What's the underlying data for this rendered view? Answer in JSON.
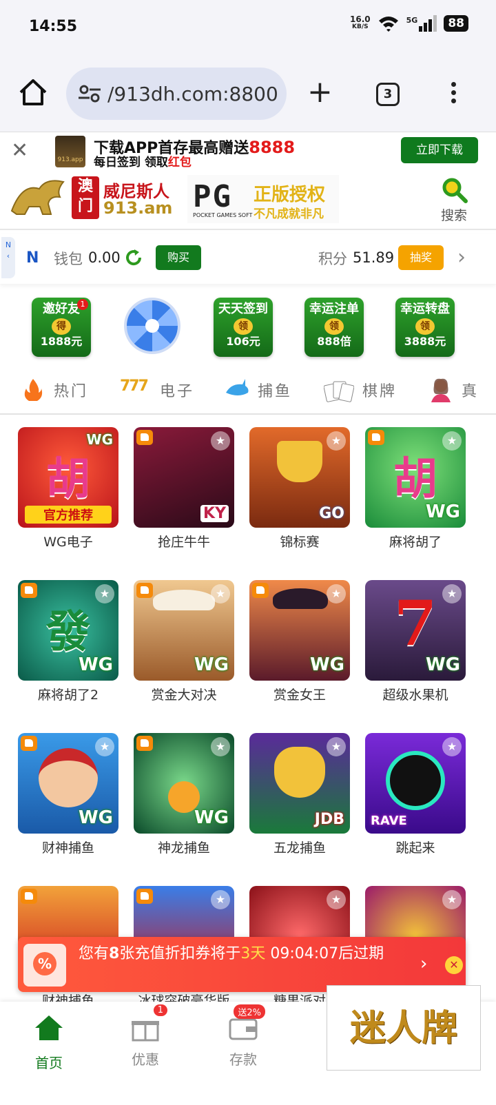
{
  "status": {
    "time": "14:55",
    "speed_value": "16.0",
    "speed_unit": "KB/S",
    "network": "5G",
    "battery": "88"
  },
  "browser": {
    "url": "/913dh.com:8800",
    "tab_count": "3"
  },
  "download_bar": {
    "line1_prefix": "下载APP首存最高赠送",
    "line1_amount": "8888",
    "line2_prefix": "每日签到 领取",
    "line2_highlight": "红包",
    "logo_caption": "913.app",
    "button": "立即下载"
  },
  "brand": {
    "macau": "澳门",
    "name": "威尼斯人",
    "domain": "913.am",
    "pg_logo": "PG",
    "pg_sub": "POCKET GAMES SOFT",
    "pg_title": "正版授权",
    "pg_slogan": "不凡成就非凡",
    "search_label": "搜索"
  },
  "wallet": {
    "side_tab": "N",
    "wallet_label": "钱包",
    "wallet_value": "0.00",
    "buy_button": "购买",
    "points_label": "积分",
    "points_value": "51.89",
    "lottery_button": "抽奖"
  },
  "promos": [
    {
      "title": "邀好友",
      "coin": "得",
      "value": "1888元",
      "badge": "1"
    },
    {
      "title": "天天签到",
      "coin": "领",
      "value": "106元"
    },
    {
      "title": "幸运注单",
      "coin": "领",
      "value": "888倍"
    },
    {
      "title": "幸运转盘",
      "coin": "领",
      "value": "3888元"
    }
  ],
  "categories": [
    "热门",
    "电子",
    "捕鱼",
    "棋牌",
    "真"
  ],
  "games": [
    {
      "name": "WG电子",
      "glyph": "胡",
      "tag": "WG",
      "caption": "官方推荐"
    },
    {
      "name": "抢庄牛牛",
      "glyph": "",
      "tag": "KY"
    },
    {
      "name": "锦标赛",
      "glyph": "",
      "tag": "GO"
    },
    {
      "name": "麻将胡了",
      "glyph": "胡",
      "tag": "WG"
    },
    {
      "name": "麻将胡了2",
      "glyph": "發",
      "tag": "WG"
    },
    {
      "name": "赏金大对决",
      "glyph": "",
      "tag": "WG"
    },
    {
      "name": "赏金女王",
      "glyph": "",
      "tag": "WG"
    },
    {
      "name": "超级水果机",
      "glyph": "7",
      "tag": "WG"
    },
    {
      "name": "财神捕鱼",
      "glyph": "",
      "tag": "WG"
    },
    {
      "name": "神龙捕鱼",
      "glyph": "",
      "tag": "WG"
    },
    {
      "name": "五龙捕鱼",
      "glyph": "",
      "tag": "JDB"
    },
    {
      "name": "跳起来",
      "glyph": "",
      "tag": "RAVE"
    },
    {
      "name": "财神捕鱼",
      "glyph": "",
      "tag": ""
    },
    {
      "name": "冰球突破豪华版",
      "glyph": "",
      "tag": ""
    },
    {
      "name": "糖果派对",
      "glyph": "",
      "tag": ""
    },
    {
      "name": "",
      "glyph": "",
      "tag": ""
    }
  ],
  "coupon": {
    "prefix": "您有",
    "count": "8",
    "middle": "张充值折扣券将于",
    "days": "3天",
    "time": "09:04:07",
    "suffix": "后过期"
  },
  "bottom_nav": [
    {
      "label": "首页"
    },
    {
      "label": "优惠",
      "badge": "1"
    },
    {
      "label": "存款",
      "badge": "送2%"
    }
  ],
  "stamp": "迷人牌",
  "colors": {
    "primary_green": "#127a1e",
    "accent_orange": "#f5a300",
    "alert_red": "#f3383a"
  }
}
